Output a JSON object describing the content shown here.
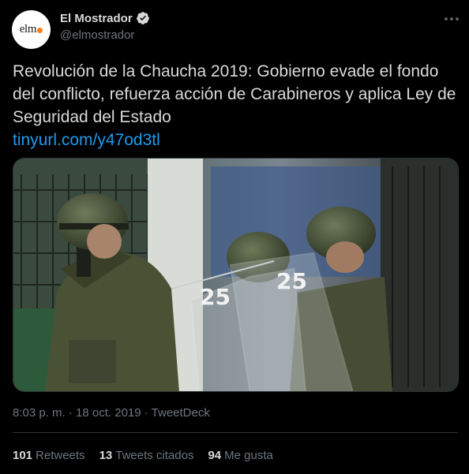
{
  "author": {
    "avatar_text": "elm",
    "display_name": "El Mostrador",
    "handle": "@elmostrador",
    "verified_icon": "verified-badge-icon"
  },
  "more_icon": "more-horizontal-icon",
  "tweet": {
    "text": "Revolución de la Chaucha 2019: Gobierno evade el fondo del conflicto, refuerza acción de Carabineros y aplica Ley de Seguridad del Estado",
    "link": "tinyurl.com/y47od3tl"
  },
  "media": {
    "shield_numbers": [
      "25",
      "25"
    ]
  },
  "meta": {
    "timestamp": "8:03 p. m. · 18 oct. 2019 · TweetDeck"
  },
  "stats": {
    "retweets_count": "101",
    "retweets_label": "Retweets",
    "quotes_count": "13",
    "quotes_label": "Tweets citados",
    "likes_count": "94",
    "likes_label": "Me gusta"
  },
  "colors": {
    "background": "#000000",
    "text": "#d9d9d9",
    "muted": "#6e767d",
    "link": "#1d9bf0",
    "avatar_dot": "#f5821f"
  }
}
